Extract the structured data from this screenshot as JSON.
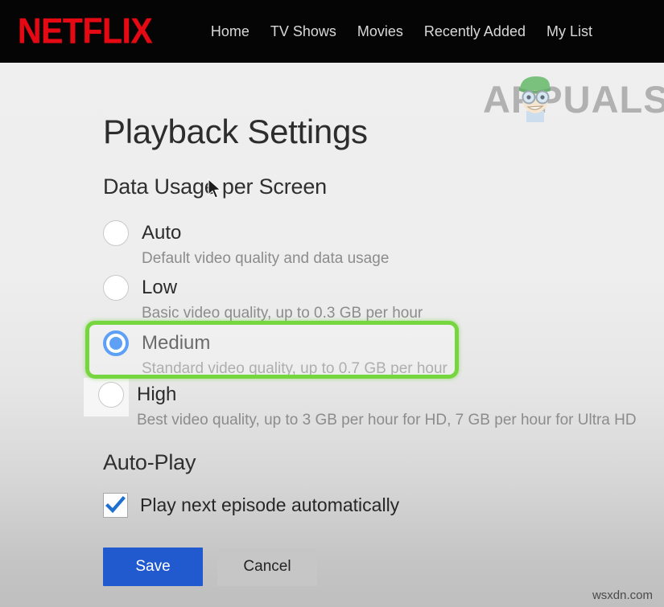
{
  "navbar": {
    "logo_text": "NETFLIX",
    "logo_color": "#e50914",
    "links": [
      {
        "label": "Home"
      },
      {
        "label": "TV Shows"
      },
      {
        "label": "Movies"
      },
      {
        "label": "Recently Added"
      },
      {
        "label": "My List"
      }
    ]
  },
  "watermarks": {
    "brand": "APPUALS",
    "footer": "wsxdn.com"
  },
  "page": {
    "title": "Playback Settings"
  },
  "data_usage": {
    "section_title": "Data Usage per Screen",
    "selected_value": "Medium",
    "highlight_color": "#76d63f",
    "options": [
      {
        "label": "Auto",
        "description": "Default video quality and data usage",
        "selected": false
      },
      {
        "label": "Low",
        "description": "Basic video quality, up to 0.3 GB per hour",
        "selected": false
      },
      {
        "label": "Medium",
        "description": "Standard video quality, up to 0.7 GB per hour",
        "selected": true
      },
      {
        "label": "High",
        "description": "Best video quality, up to 3 GB per hour for HD, 7 GB per hour for Ultra HD",
        "selected": false
      }
    ]
  },
  "auto_play": {
    "section_title": "Auto-Play",
    "checkbox_label": "Play next episode automatically",
    "checked": true
  },
  "actions": {
    "save_label": "Save",
    "cancel_label": "Cancel",
    "save_color": "#2159cf",
    "cancel_color": "#c6c6c6"
  }
}
